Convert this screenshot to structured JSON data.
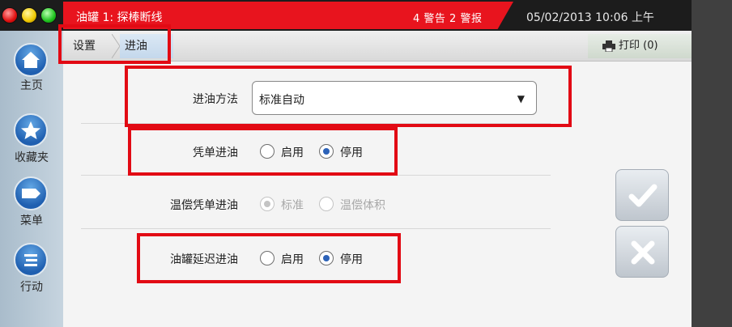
{
  "titlebar": {
    "alarm_text": "油罐 1: 探棒断线",
    "warnings_text": "4 警告 2 警报",
    "datetime": "05/02/2013 10:06 上午"
  },
  "sidebar": {
    "items": [
      {
        "label": "主页",
        "icon": "home-icon"
      },
      {
        "label": "收藏夹",
        "icon": "star-icon"
      },
      {
        "label": "菜单",
        "icon": "tag-icon"
      },
      {
        "label": "行动",
        "icon": "list-icon"
      }
    ]
  },
  "breadcrumb": {
    "items": [
      "设置",
      "进油"
    ],
    "print_label": "打印 (0)"
  },
  "form": {
    "delivery_method": {
      "label": "进油方法",
      "value": "标准自动"
    },
    "ticketed_delivery": {
      "label": "凭单进油",
      "options": [
        "启用",
        "停用"
      ],
      "selected": "停用"
    },
    "temp_comp_ticketed": {
      "label": "温偿凭单进油",
      "options": [
        "标准",
        "温偿体积"
      ],
      "selected": "标准",
      "disabled": true
    },
    "tank_delay_delivery": {
      "label": "油罐延迟进油",
      "options": [
        "启用",
        "停用"
      ],
      "selected": "停用"
    }
  },
  "actions": {
    "confirm_icon": "checkmark-icon",
    "cancel_icon": "x-icon"
  },
  "colors": {
    "alarm_red": "#e8141e",
    "highlight_red": "#e20a14",
    "accent_blue": "#1f5fb0"
  }
}
